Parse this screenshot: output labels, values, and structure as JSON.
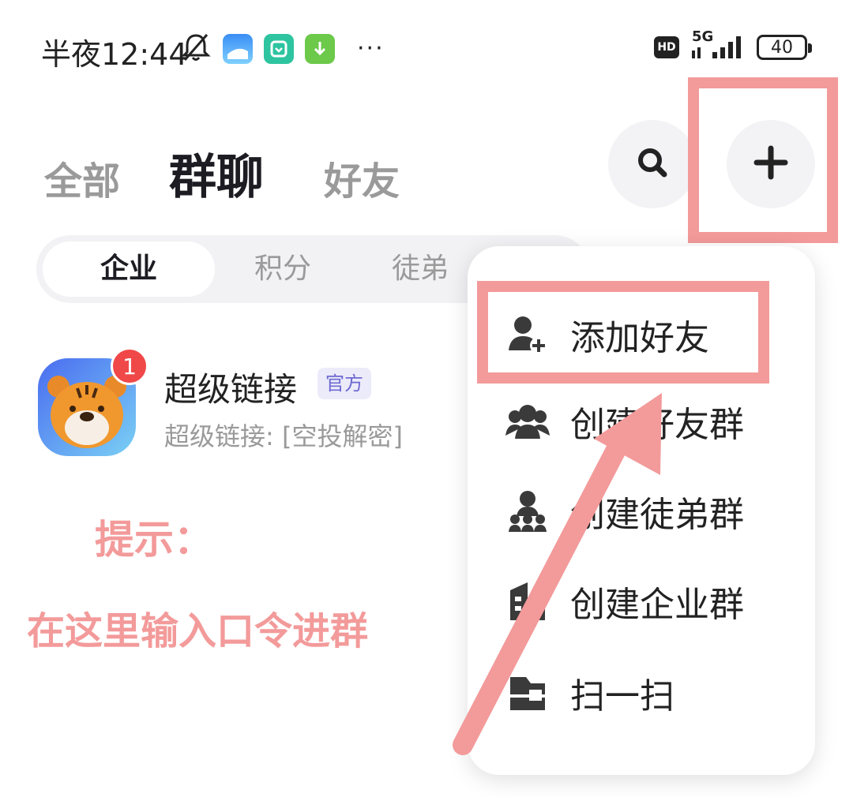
{
  "status_bar": {
    "time": "半夜12:44",
    "hd": "HD",
    "network": "5G",
    "battery": "40",
    "more": "···"
  },
  "top_tabs": {
    "all": "全部",
    "group": "群聊",
    "friend": "好友"
  },
  "segments": {
    "enterprise": "企业",
    "points": "积分",
    "apprentice": "徒弟"
  },
  "conversation": {
    "title": "超级链接",
    "tag": "官方",
    "subtitle": "超级链接: [空投解密]",
    "unread": "1"
  },
  "hint": {
    "title": "提示：",
    "text": "在这里输入口令进群"
  },
  "menu": {
    "items": [
      {
        "label": "添加好友",
        "icon": "add-friend-icon"
      },
      {
        "label": "创建好友群",
        "icon": "friend-group-icon"
      },
      {
        "label": "创建徒弟群",
        "icon": "apprentice-group-icon"
      },
      {
        "label": "创建企业群",
        "icon": "enterprise-group-icon"
      },
      {
        "label": "扫一扫",
        "icon": "scan-icon"
      }
    ]
  },
  "colors": {
    "highlight": "#f39a9a",
    "accent_tag": "#6e6ad2",
    "badge": "#f04848"
  }
}
